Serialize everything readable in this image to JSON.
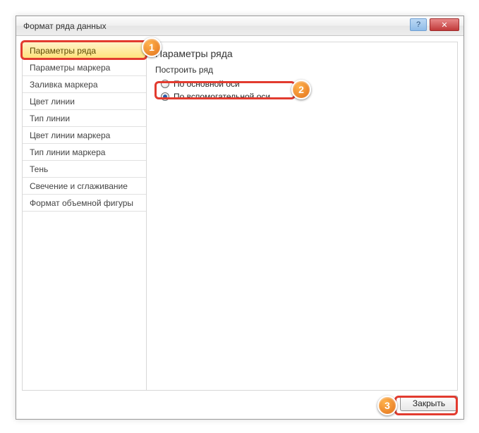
{
  "window": {
    "title": "Формат ряда данных",
    "help_symbol": "?",
    "close_symbol": "✕"
  },
  "sidebar": {
    "items": [
      {
        "label": "Параметры ряда",
        "selected": true
      },
      {
        "label": "Параметры маркера",
        "selected": false
      },
      {
        "label": "Заливка маркера",
        "selected": false
      },
      {
        "label": "Цвет линии",
        "selected": false
      },
      {
        "label": "Тип линии",
        "selected": false
      },
      {
        "label": "Цвет линии маркера",
        "selected": false
      },
      {
        "label": "Тип линии маркера",
        "selected": false
      },
      {
        "label": "Тень",
        "selected": false
      },
      {
        "label": "Свечение и сглаживание",
        "selected": false
      },
      {
        "label": "Формат объемной фигуры",
        "selected": false
      }
    ]
  },
  "pane": {
    "title": "Параметры ряда",
    "group_label": "Построить ряд",
    "radios": [
      {
        "label": "По основной оси",
        "checked": false
      },
      {
        "label": "По вспомогательной оси",
        "checked": true
      }
    ]
  },
  "footer": {
    "close_label": "Закрыть"
  },
  "annotations": {
    "b1": "1",
    "b2": "2",
    "b3": "3"
  }
}
